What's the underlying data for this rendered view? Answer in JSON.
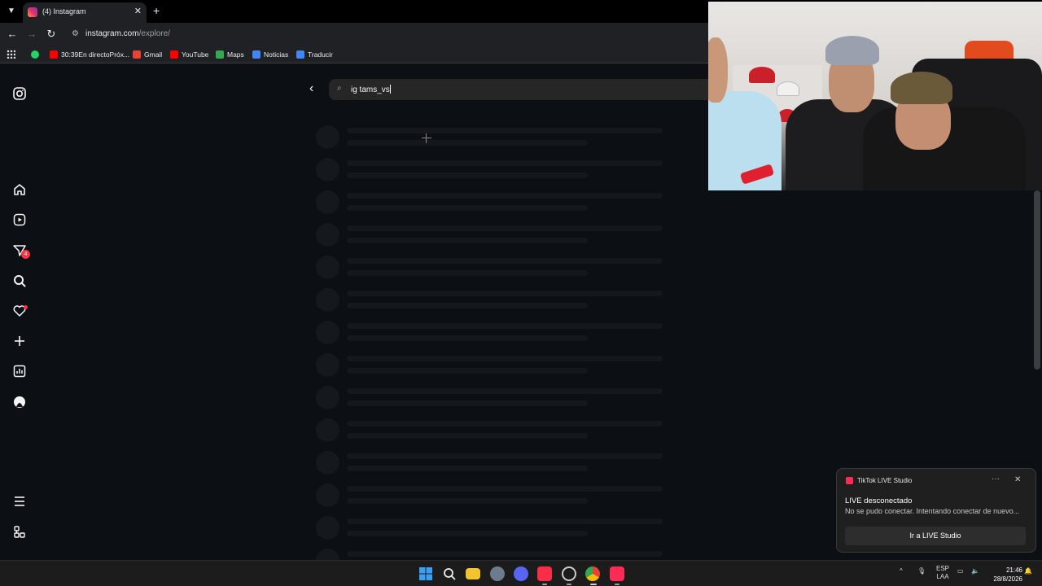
{
  "browser": {
    "tab_title": "(4) Instagram",
    "tab_close": "✕",
    "new_tab": "+",
    "url_host": "instagram.com",
    "url_path": "/explore/",
    "bookmarks": [
      "30:39En directoPróx...",
      "Gmail",
      "YouTube",
      "Maps",
      "Noticias",
      "Traducir"
    ]
  },
  "instagram": {
    "notification_badge": "4",
    "search_value": "ig tams_vs"
  },
  "toast": {
    "app_name": "TikTok LIVE Studio",
    "title": "LIVE desconectado",
    "body": "No se pudo conectar. Intentando conectar de nuevo...",
    "button": "Ir a LIVE Studio",
    "more": "···",
    "close": "✕"
  },
  "taskbar": {
    "lang_line1": "ESP",
    "lang_line2": "LAA",
    "time": "21:46",
    "date": "28/8/2026"
  },
  "colors": {
    "background": "#0c1014",
    "instagram_badge": "#ff3040",
    "tiktok_accent": "#fe2c55"
  }
}
